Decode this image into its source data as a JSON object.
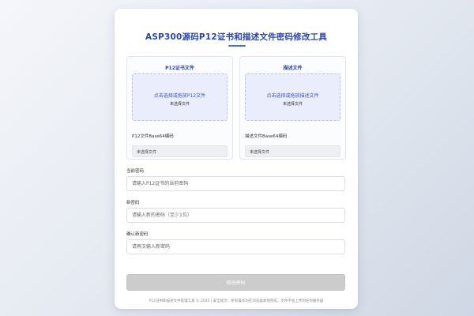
{
  "title": "ASP300源码P12证书和描述文件密码修改工具",
  "p12_panel": {
    "title": "P12证书文件",
    "drop_prompt": "点击选择或拖放P12文件",
    "status": "未选择文件",
    "base64_label": "P12文件Base64编码",
    "base64_value": "未选择文件"
  },
  "profile_panel": {
    "title": "描述文件",
    "drop_prompt": "点击选择或拖放描述文件",
    "status": "未选择文件",
    "base64_label": "描述文件Base64编码",
    "base64_value": "未选择文件"
  },
  "current_password": {
    "label": "当前密码",
    "placeholder": "请输入P12证书的当前密码",
    "value": ""
  },
  "new_password": {
    "label": "新密码",
    "placeholder": "请输入新的密码（至少1位）",
    "value": ""
  },
  "confirm_password": {
    "label": "确认新密码",
    "placeholder": "请再次输入新密码",
    "value": ""
  },
  "submit_label": "修改密码",
  "footer": "P12证书和描述文件处理工具 © 2025 | 安全提示：所有操作均在浏览器本地完成，文件不会上传到任何服务器",
  "colors": {
    "accent": "#2a45b8",
    "dropzone_bg": "#e9edfc",
    "button_disabled": "#cccccc"
  }
}
